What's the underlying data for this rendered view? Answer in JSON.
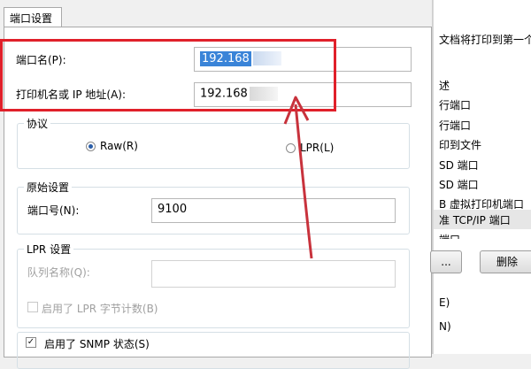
{
  "tab": {
    "label": "端口设置"
  },
  "port_name": {
    "label": "端口名(P):",
    "value": "192.168"
  },
  "printer_address": {
    "label": "打印机名或 IP 地址(A):",
    "value": "192.168"
  },
  "protocol": {
    "title": "协议",
    "options": [
      "Raw(R)",
      "LPR(L)"
    ],
    "selected": "Raw(R)"
  },
  "raw_settings": {
    "title": "原始设置",
    "port_number_label": "端口号(N):",
    "port_number_value": "9100"
  },
  "lpr_settings": {
    "title": "LPR 设置",
    "queue_label": "队列名称(Q):",
    "queue_value": "",
    "byte_count_label": "启用了 LPR 字节计数(B)",
    "byte_count_checked": false
  },
  "snmp": {
    "label": "启用了 SNMP 状态(S)",
    "checked": true
  },
  "background_window": {
    "top_text": "文档将打印到第一个",
    "list_header": "述",
    "items": [
      "行端口",
      "行端口",
      "印到文件",
      "SD 端口",
      "SD 端口",
      "B 虚拟打印机端口",
      "准 TCP/IP 端口",
      "端口"
    ],
    "button_left": "...",
    "button_right": "删除",
    "footer_1": "E)",
    "footer_2": "N)"
  },
  "colors": {
    "highlight": "#e0202a",
    "arrow": "#c8323c",
    "selection": "#3a84d8"
  }
}
